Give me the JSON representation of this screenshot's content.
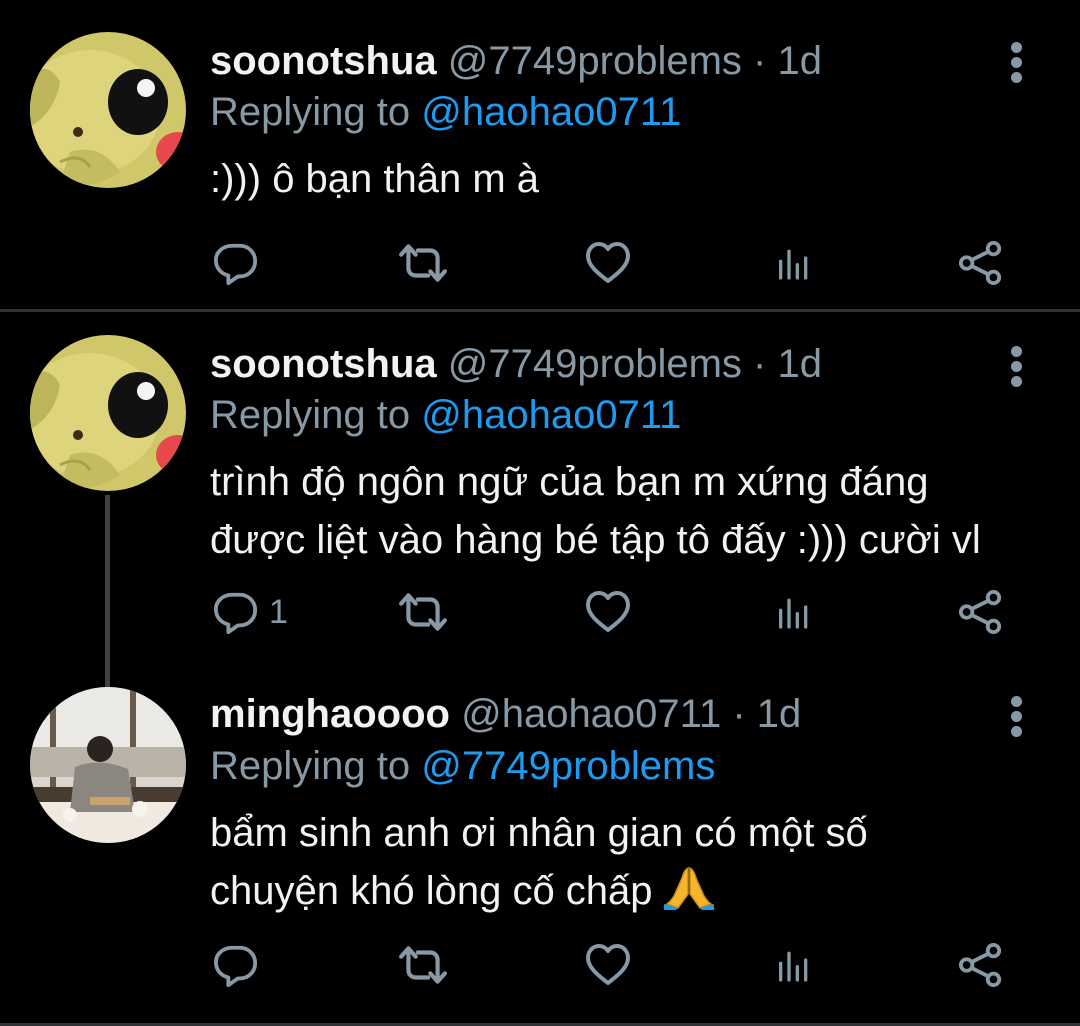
{
  "tweets": [
    {
      "display_name": "soonotshua",
      "handle": "@7749problems",
      "separator": "·",
      "time": "1d",
      "replying_prefix": "Replying to",
      "replying_to": "@haohao0711",
      "text_lines": [
        ":))) ô bạn thân m à"
      ],
      "reply_count": "",
      "avatar": "pikachu-plush"
    },
    {
      "display_name": "soonotshua",
      "handle": "@7749problems",
      "separator": "·",
      "time": "1d",
      "replying_prefix": "Replying to",
      "replying_to": "@haohao0711",
      "text_lines": [
        "trình độ ngôn ngữ của bạn m xứng đáng",
        "được liệt vào hàng bé tập tô đấy :))) cười vl"
      ],
      "reply_count": "1",
      "avatar": "pikachu-plush"
    },
    {
      "display_name": "minghaoooo",
      "handle": "@haohao0711",
      "separator": "·",
      "time": "1d",
      "replying_prefix": "Replying to",
      "replying_to": "@7749problems",
      "text_lines": [
        "bẩm sinh anh ơi nhân gian có một số",
        "chuyện khó lòng cố chấp"
      ],
      "emoji": "🙏",
      "reply_count": "",
      "avatar": "person-photo"
    }
  ],
  "icons": {
    "reply": "reply-icon",
    "retweet": "retweet-icon",
    "like": "heart-icon",
    "analytics": "analytics-icon",
    "share": "share-icon",
    "more": "more-vertical-icon"
  },
  "colors": {
    "background": "#000000",
    "primary_text": "#f2f2f2",
    "secondary_text": "#8899a6",
    "mention": "#1d9bf0",
    "divider": "#2f3336"
  }
}
